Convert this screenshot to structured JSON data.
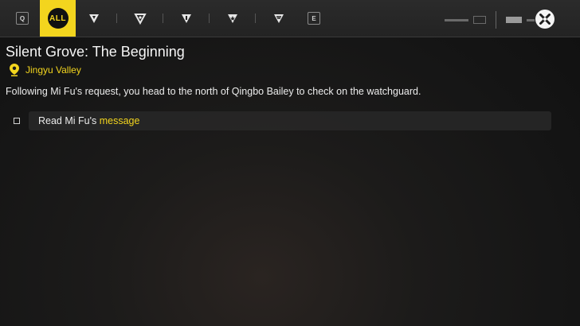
{
  "tabs": {
    "left_key": "Q",
    "right_key": "E",
    "items": [
      {
        "label": "ALL",
        "icon": "all-badge",
        "active": true
      },
      {
        "icon": "main-quest-icon"
      },
      {
        "icon": "side-quest-icon"
      },
      {
        "icon": "exploration-quest-icon"
      },
      {
        "icon": "event-quest-icon"
      },
      {
        "icon": "companion-quest-icon"
      }
    ]
  },
  "quest": {
    "title": "Silent Grove: The Beginning",
    "location": "Jingyu Valley",
    "description": "Following Mi Fu's request, you head to the north of Qingbo Bailey to check on the watchguard.",
    "objective": {
      "prefix": "Read Mi Fu's ",
      "highlight": "message"
    }
  },
  "colors": {
    "accent": "#f3d51e",
    "panel": "#282828"
  }
}
